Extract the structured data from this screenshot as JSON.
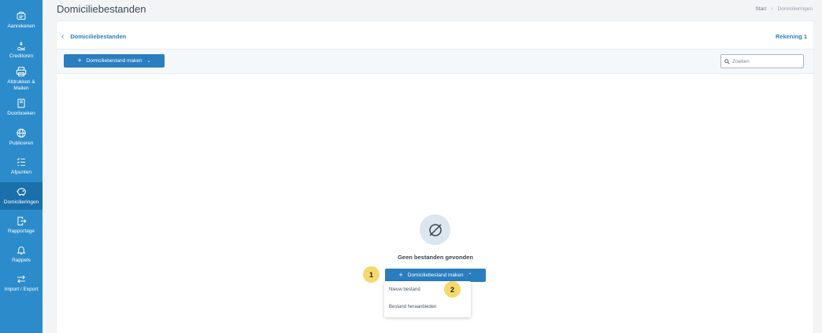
{
  "sidebar": {
    "items": [
      {
        "label": "Aanrekenen",
        "icon": "invoice-icon"
      },
      {
        "label": "Creditoren",
        "icon": "hand-money-icon"
      },
      {
        "label": "Afdrukken & Mailen",
        "icon": "printer-icon"
      },
      {
        "label": "Doorboeken",
        "icon": "book-icon"
      },
      {
        "label": "Publiceren",
        "icon": "globe-icon"
      },
      {
        "label": "Afpunten",
        "icon": "checklist-icon"
      },
      {
        "label": "Domicilieringen",
        "icon": "piggy-bank-icon",
        "active": true
      },
      {
        "label": "Rapportage",
        "icon": "export-file-icon"
      },
      {
        "label": "Rappels",
        "icon": "bell-icon"
      },
      {
        "label": "Import / Export",
        "icon": "arrows-swap-icon"
      }
    ]
  },
  "header": {
    "title": "Domiciliebestanden",
    "breadcrumb": [
      "Start",
      "Domicilieringen"
    ]
  },
  "card": {
    "back_label": "Domiciliebestanden",
    "account": "Rekening 1"
  },
  "toolbar": {
    "create_label": "Domiciliebestand maken",
    "search_placeholder": "Zoeken"
  },
  "empty_state": {
    "message": "Geen bestanden gevonden",
    "create_label": "Domiciliebestand maken",
    "menu": [
      "Nieuw bestand",
      "Bestand heraanbieden"
    ]
  },
  "steps": [
    "1",
    "2"
  ],
  "colors": {
    "sidebar": "#2c8ccb",
    "active": "#1a70ab",
    "primary": "#2a7ec0",
    "marker": "#f5d96b"
  }
}
